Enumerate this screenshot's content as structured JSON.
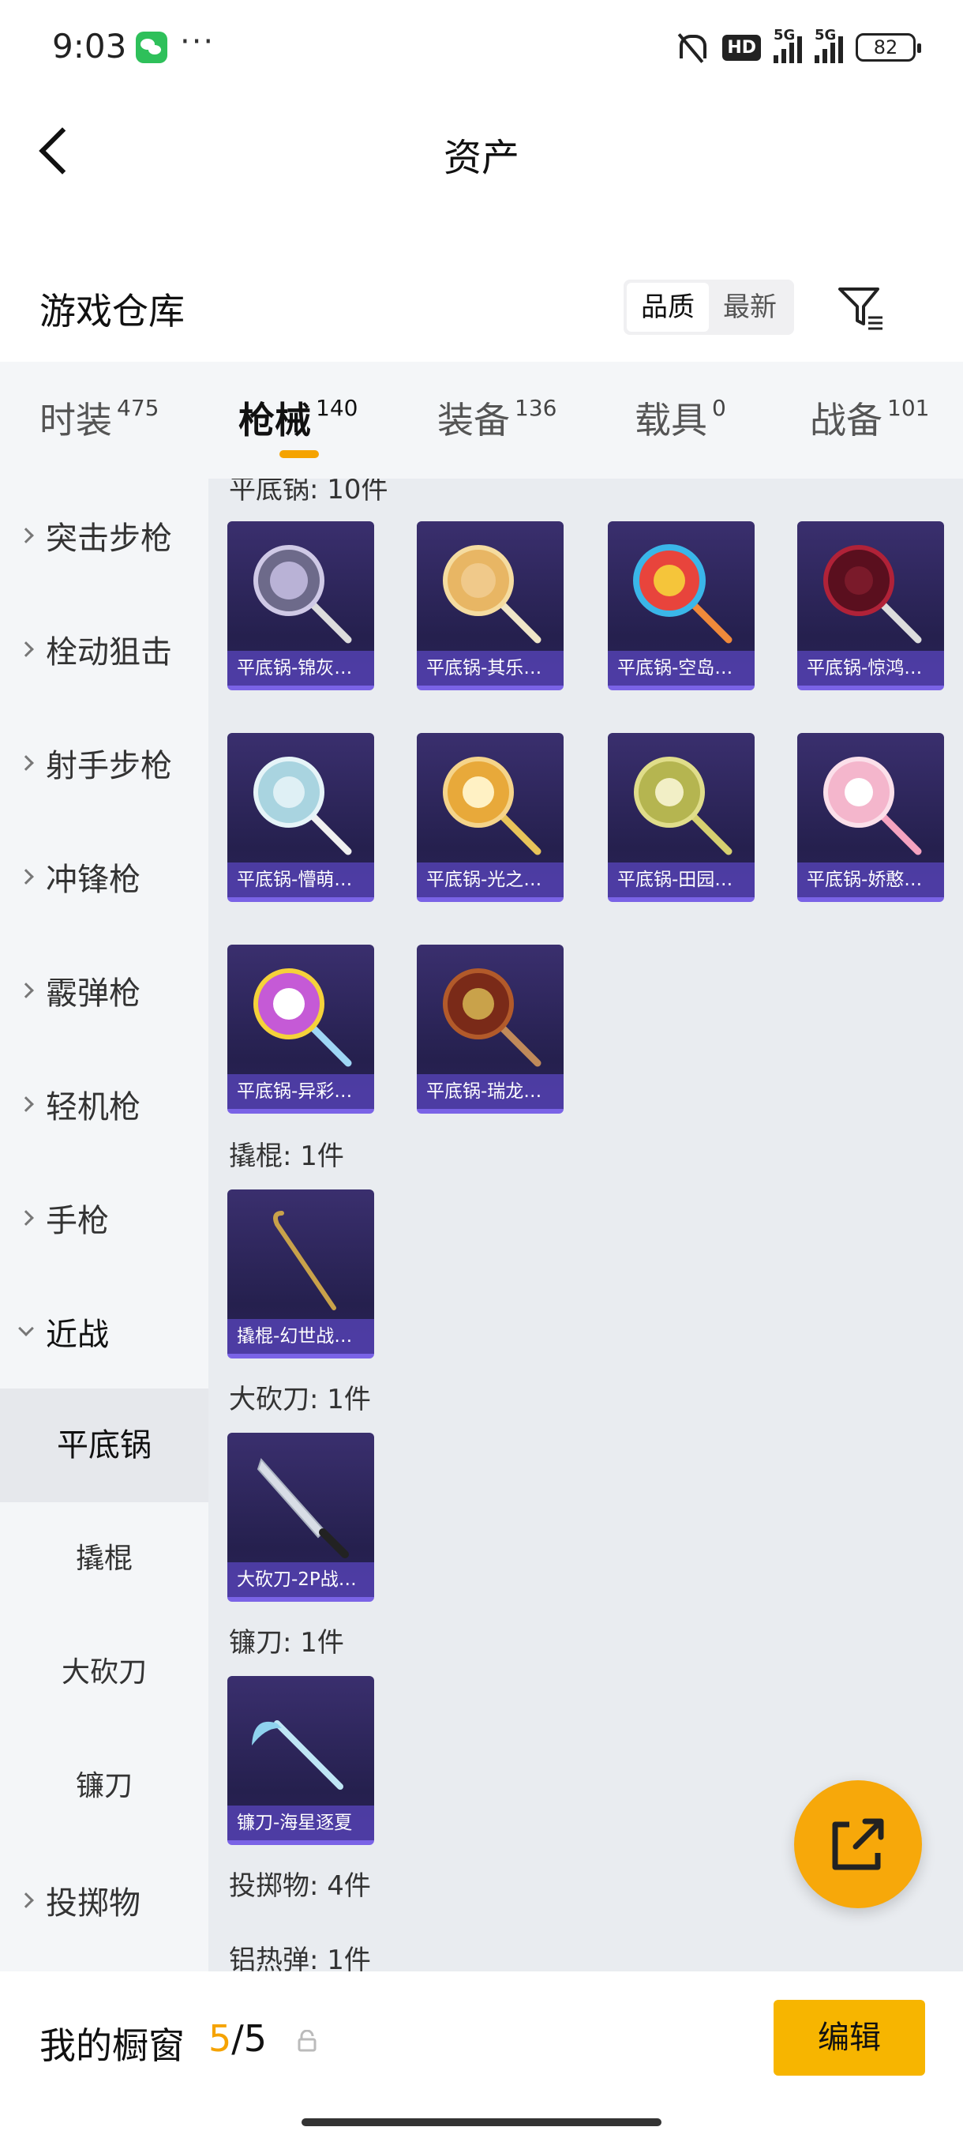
{
  "status_bar": {
    "time": "9:03",
    "dots": "···",
    "hd": "HD",
    "signal1": "5G",
    "signal2": "5G",
    "battery": "82",
    "icons": [
      "wechat-icon",
      "mute-icon",
      "hd-icon",
      "signal-icon",
      "signal-icon",
      "battery-icon"
    ]
  },
  "header": {
    "title": "资产"
  },
  "warehouse": {
    "title": "游戏仓库",
    "sort": [
      "品质",
      "最新"
    ],
    "sort_active": "品质"
  },
  "tabs": [
    {
      "label": "时装",
      "count": "475"
    },
    {
      "label": "枪械",
      "count": "140"
    },
    {
      "label": "装备",
      "count": "136"
    },
    {
      "label": "载具",
      "count": "0"
    },
    {
      "label": "战备",
      "count": "101"
    }
  ],
  "tab_active": "枪械",
  "sidebar": {
    "categories": [
      "突击步枪",
      "栓动狙击",
      "射手步枪",
      "冲锋枪",
      "霰弹枪",
      "轻机枪",
      "手枪",
      "近战"
    ],
    "open_category": "近战",
    "subitems": [
      "平底锅",
      "撬棍",
      "大砍刀",
      "镰刀"
    ],
    "active_sub": "平底锅",
    "after": [
      "投掷物"
    ]
  },
  "content": {
    "sections": [
      {
        "label": "平底锅: 10件"
      },
      {
        "label": "撬棍: 1件"
      },
      {
        "label": "大砍刀: 1件"
      },
      {
        "label": "镰刀: 1件"
      },
      {
        "label": "投掷物: 4件"
      },
      {
        "label": "铝热弹: 1件"
      }
    ],
    "pan_items": [
      "平底锅-锦灰…",
      "平底锅-其乐…",
      "平底锅-空岛…",
      "平底锅-惊鸿…",
      "平底锅-懵萌…",
      "平底锅-光之…",
      "平底锅-田园…",
      "平底锅-娇憨…",
      "平底锅-异彩…",
      "平底锅-瑞龙…"
    ],
    "crowbar_items": [
      "撬棍-幻世战…"
    ],
    "machete_items": [
      "大砍刀-2P战…"
    ],
    "sickle_items": [
      "镰刀-海星逐夏"
    ]
  },
  "bottom_bar": {
    "label": "我的橱窗",
    "current": "5",
    "total": "/5",
    "edit": "编辑"
  },
  "colors": {
    "accent": "#f5a300",
    "card_bg": "#2c2560",
    "card_border": "#7a63e6"
  }
}
